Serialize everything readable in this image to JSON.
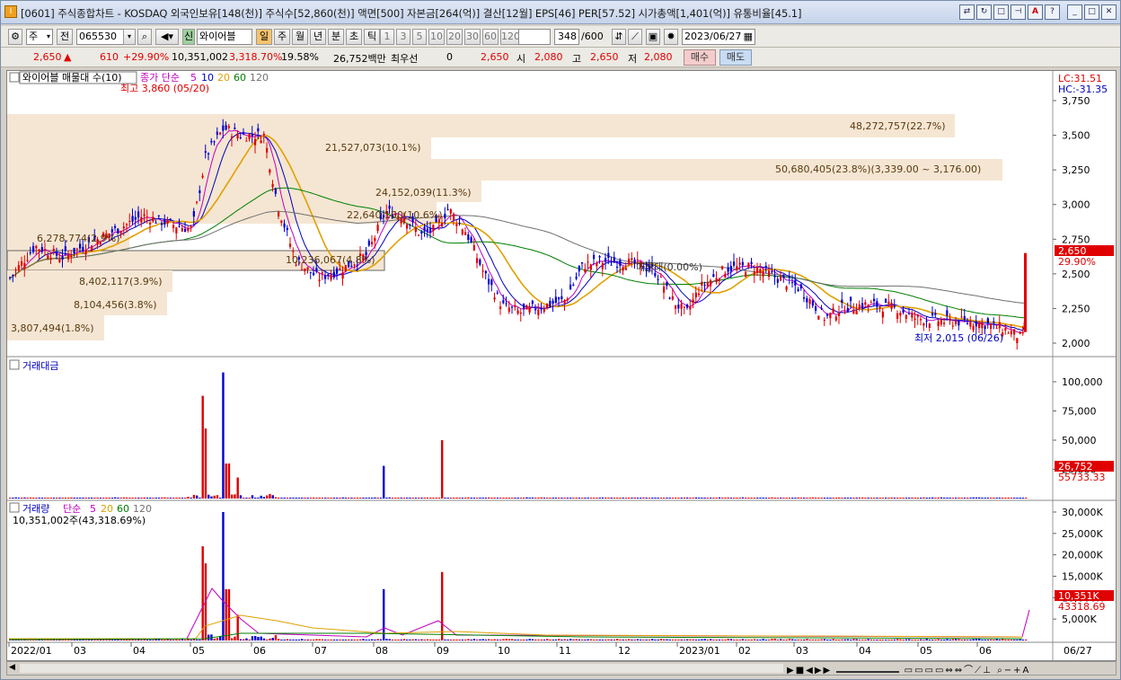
{
  "titlebar": {
    "title": "[0601] 주식종합차트 - KOSDAQ 외국인보유[148(천)] 주식수[52,860(천)] 액면[500] 자본금[264(억)] 결산[12월] EPS[46] PER[57.52] 시가총액[1,401(억)] 유통비율[45.1]"
  },
  "toolbar": {
    "type_select": "주",
    "all_label": "전",
    "code": "065530",
    "search_label": "Q",
    "new_label": "신",
    "stock_name": "와이어블",
    "period_tabs": [
      "일",
      "주",
      "월",
      "년",
      "분",
      "초",
      "틱"
    ],
    "minute_tabs": [
      "1",
      "3",
      "5",
      "10",
      "20",
      "30",
      "60",
      "120"
    ],
    "count_value": "348",
    "count_total": "/600",
    "date": "2023/06/27"
  },
  "quote": {
    "price": "2,650",
    "change": "610",
    "change_pct": "+29.90%",
    "volume": "10,351,002",
    "volume_pct": "3,318.70%",
    "turnover": "19.58%",
    "amount": "26,752백만",
    "priority_label": "최우선",
    "priority_value": "0",
    "ask": "2,650",
    "open_label": "시",
    "open": "2,080",
    "high_label": "고",
    "high": "2,650",
    "low_label": "저",
    "low": "2,080",
    "buy_label": "매수",
    "sell_label": "매도"
  },
  "price_panel": {
    "legend_box": "와이어블 매물대 수(10)",
    "legend_ma_title": "종가 단순",
    "legend_ma": [
      "5",
      "10",
      "20",
      "60",
      "120"
    ],
    "ma_colors": [
      "#c000c0",
      "#0000c0",
      "#e0a000",
      "#008000",
      "#707070"
    ],
    "high_marker": "최고 3,860 (05/20)",
    "low_marker": "최저 2,015 (06/26)",
    "lc_label": "LC:31.51",
    "hc_label": "HC:-31.35",
    "y_ticks": [
      "3,750",
      "3,500",
      "3,250",
      "3,000",
      "2,750",
      "2,500",
      "2,250",
      "2,000"
    ],
    "current_price_tag": "2,650",
    "current_pct_tag": "29.90%",
    "volume_profile": [
      {
        "label": "48,272,757(22.7%)"
      },
      {
        "label": "21,527,073(10.1%)"
      },
      {
        "label": "50,680,405(23.8%)(3,339.00 ~ 3,176.00)"
      },
      {
        "label": "24,152,039(11.3%)"
      },
      {
        "label": "22,640,100(10.6%)"
      },
      {
        "label": "6,278,774(2.9%)"
      },
      {
        "label": "10,236,067(4.8%)"
      },
      {
        "label": "8,402,117(3.9%)"
      },
      {
        "label": "8,104,456(3.8%)"
      },
      {
        "label": "3,807,494(1.8%)"
      }
    ],
    "annotation": "매물대(0.00%)"
  },
  "amount_panel": {
    "title": "거래대금",
    "y_ticks": [
      "100,000",
      "75,000",
      "50,000",
      "25,000"
    ],
    "current_tag": "26,752",
    "ma_tag": "55733.33"
  },
  "volume_panel": {
    "title": "거래량",
    "legend_ma_title": "단순",
    "legend_ma": [
      "5",
      "20",
      "60",
      "120"
    ],
    "info": "10,351,002주(43,318.69%)",
    "y_ticks": [
      "30,000K",
      "25,000K",
      "20,000K",
      "15,000K",
      "10,000K",
      "5,000K"
    ],
    "current_tag": "10,351K",
    "ma_tag": "43318.69"
  },
  "x_axis": {
    "labels": [
      "2022/01",
      "03",
      "04",
      "05",
      "06",
      "07",
      "08",
      "09",
      "10",
      "11",
      "12",
      "2023/01",
      "02",
      "03",
      "04",
      "05",
      "06"
    ],
    "last_label": "06/27"
  }
}
